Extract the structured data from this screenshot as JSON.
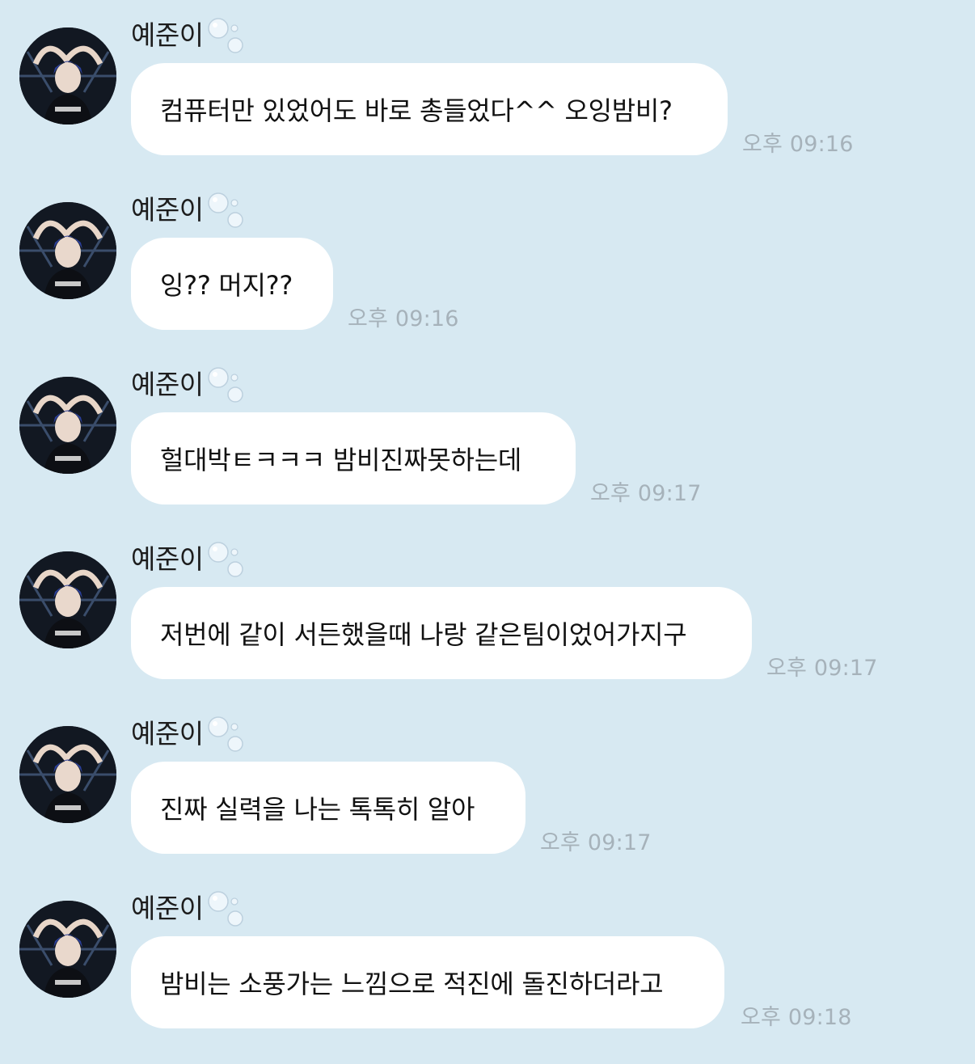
{
  "sender": {
    "name": "예준이"
  },
  "messages": [
    {
      "text": "컴퓨터만 있었어도 바로 총들었다^^ 오잉밤비?",
      "time": "오후 09:16"
    },
    {
      "text": "잉?? 머지??",
      "time": "오후 09:16"
    },
    {
      "text": "헐대박ㅌㅋㅋㅋ 밤비진짜못하는데",
      "time": "오후 09:17"
    },
    {
      "text": "저번에 같이 서든했을때 나랑 같은팀이었어가지구",
      "time": "오후 09:17"
    },
    {
      "text": "진짜 실력을 나는 톡톡히 알아",
      "time": "오후 09:17"
    },
    {
      "text": "밤비는 소풍가는 느낌으로 적진에 돌진하더라고",
      "time": "오후 09:18"
    }
  ],
  "colors": {
    "background": "#d7e9f2",
    "bubble": "#ffffff",
    "time": "#a6b2ba",
    "avatar_bg": "#121822",
    "avatar_accent": "#2a3f8f"
  },
  "icons": {
    "avatar": "profile-photo",
    "name_suffix": "bubbles-icon"
  }
}
